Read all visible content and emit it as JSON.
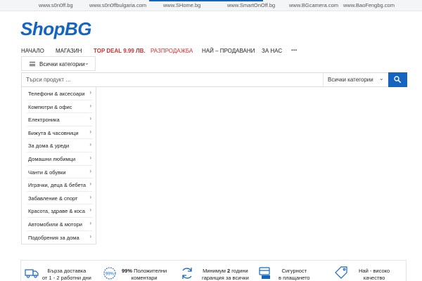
{
  "topbar": {
    "sites": [
      "www.s0n0ff.bg",
      "www.s0n0ffbulgaria.com",
      "www.SHome.bg",
      "www.SmartOnOff.bg",
      "www.BGcamera.com",
      "www.BaoFengbg.com"
    ]
  },
  "logo": {
    "text": "ShopBG"
  },
  "nav": {
    "items": [
      "НАЧАЛО",
      "МАГАЗИН",
      "TOP DEAL 9.99 ЛВ.",
      "РАЗПРОДАЖБА",
      "НАЙ – ПРОДАВАНИ",
      "ЗА НАС",
      "..."
    ]
  },
  "category_toggle": {
    "label": "Всички категории"
  },
  "search": {
    "placeholder": "Търси продукт …",
    "category_value": "Всички категории"
  },
  "categories": [
    "Телефони & аксесоари",
    "Компютри & офис",
    "Електроника",
    "Бижута & часовници",
    "За дома & уреди",
    "Домашни любимци",
    "Чанти & обувки",
    "Играчки, деца & бебета",
    "Забавление & спорт",
    "Красота, здраве & коса",
    "Автомобили & мотори",
    "Подобрения за дома"
  ],
  "features": [
    {
      "line1": "Бърза доставка",
      "line2": "от 1 - 2 работни дни"
    },
    {
      "line1_bold": "99%",
      "line1": " Положителни",
      "line2": "коментари"
    },
    {
      "line1": "Минимум ",
      "line1_bold": "2",
      "line1_end": " години",
      "line2": "гаранция за всички"
    },
    {
      "line1": "Сигурност",
      "line2": "в плащането"
    },
    {
      "line1": "Най - високо",
      "line2": "качество"
    }
  ],
  "colors": {
    "brand": "#1565c0",
    "deal": "#d32f2f",
    "border": "#e2e2e2"
  },
  "icons": {
    "search_button": "search-icon",
    "features": [
      "truck-icon",
      "percent-badge-icon",
      "refresh-icon",
      "secure-payment-icon",
      "quality-tag-icon"
    ]
  }
}
